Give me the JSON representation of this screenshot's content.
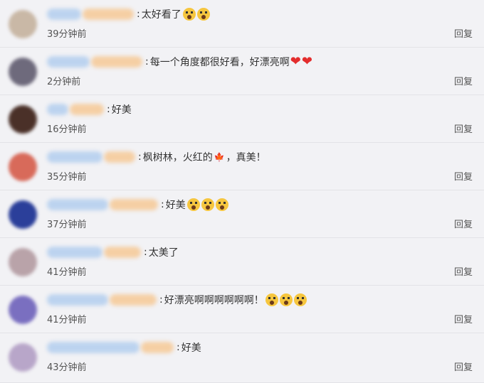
{
  "comments": [
    {
      "text": "太好看了",
      "emoji_count": 2,
      "hearts": 0,
      "time": "39分钟前",
      "reply": "回复",
      "avatar_color": "#c9b8a6"
    },
    {
      "text": "每一个角度都很好看，好漂亮啊",
      "emoji_count": 0,
      "hearts": 2,
      "time": "2分钟前",
      "reply": "回复",
      "avatar_color": "#6e6a7c"
    },
    {
      "text": "好美",
      "emoji_count": 0,
      "hearts": 0,
      "time": "16分钟前",
      "reply": "回复",
      "avatar_color": "#4a3028"
    },
    {
      "text": "枫树林，火红的",
      "text_after": "，真美！",
      "has_leaf": true,
      "emoji_count": 0,
      "hearts": 0,
      "time": "35分钟前",
      "reply": "回复",
      "avatar_color": "#d86a5a"
    },
    {
      "text": "好美",
      "emoji_count": 3,
      "hearts": 0,
      "time": "37分钟前",
      "reply": "回复",
      "avatar_color": "#2b3f9a"
    },
    {
      "text": "太美了",
      "emoji_count": 0,
      "hearts": 0,
      "time": "41分钟前",
      "reply": "回复",
      "avatar_color": "#b9a3a9"
    },
    {
      "text": "好漂亮啊啊啊啊啊啊！",
      "emoji_count": 3,
      "hearts": 0,
      "time": "41分钟前",
      "reply": "回复",
      "avatar_color": "#7a6fc0"
    },
    {
      "text": "好美",
      "emoji_count": 0,
      "hearts": 0,
      "time": "43分钟前",
      "reply": "回复",
      "avatar_color": "#b8a6c9"
    }
  ],
  "separator": ":",
  "icons": {
    "emoji": "scared-face-emoji-icon",
    "heart": "red-heart-icon",
    "leaf": "maple-leaf-icon"
  }
}
